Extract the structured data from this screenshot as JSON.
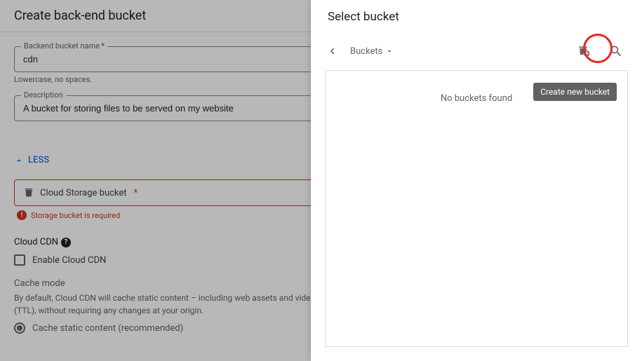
{
  "left": {
    "title": "Create back-end bucket",
    "name_field": {
      "label": "Backend bucket name",
      "value": "cdn",
      "help": "Lowercase, no spaces."
    },
    "descr_field": {
      "label": "Description",
      "value": "A bucket for storing files to be served on my website"
    },
    "less_toggle": "LESS",
    "bucket_selector_label": "Cloud Storage bucket",
    "bucket_error": "Storage bucket is required",
    "cdn_heading": "Cloud CDN",
    "cdn_checkbox_label": "Enable Cloud CDN",
    "cache_mode_heading": "Cache mode",
    "cache_mode_descr": "By default, Cloud CDN will cache static content – including web assets and video, that are not explicitly marked as private for the configured default time to live (TTL), without requiring any changes at your origin.",
    "cache_radio_label": "Cache static content (recommended)"
  },
  "right": {
    "title": "Select bucket",
    "crumb": "Buckets",
    "empty_msg": "No buckets found",
    "tooltip": "Create new bucket"
  }
}
